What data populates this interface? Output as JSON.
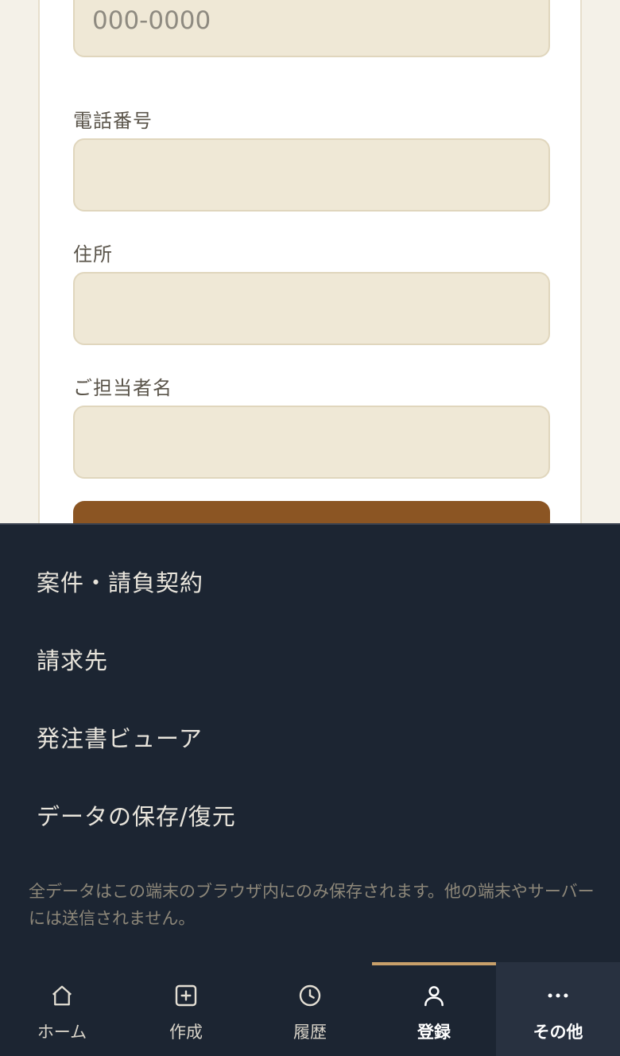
{
  "form": {
    "postal_code": {
      "placeholder": "000-0000",
      "value": ""
    },
    "phone": {
      "label": "電話番号",
      "value": ""
    },
    "address": {
      "label": "住所",
      "value": ""
    },
    "contact_person": {
      "label": "ご担当者名",
      "value": ""
    }
  },
  "menu": {
    "items": [
      {
        "label": "案件・請負契約"
      },
      {
        "label": "請求先"
      },
      {
        "label": "発注書ビューア"
      },
      {
        "label": "データの保存/復元"
      }
    ],
    "notice": "全データはこの端末のブラウザ内にのみ保存されます。他の端末やサーバーには送信されません。"
  },
  "nav": {
    "items": [
      {
        "label": "ホーム",
        "icon": "home-icon"
      },
      {
        "label": "作成",
        "icon": "plus-square-icon"
      },
      {
        "label": "履歴",
        "icon": "clock-icon"
      },
      {
        "label": "登録",
        "icon": "user-icon",
        "active": true
      },
      {
        "label": "その他",
        "icon": "more-icon",
        "highlight": true
      }
    ]
  },
  "colors": {
    "sheet_bg": "#1c2532",
    "accent": "#c8a06a",
    "primary_button": "#8b5523",
    "input_bg": "#efe8d6"
  }
}
